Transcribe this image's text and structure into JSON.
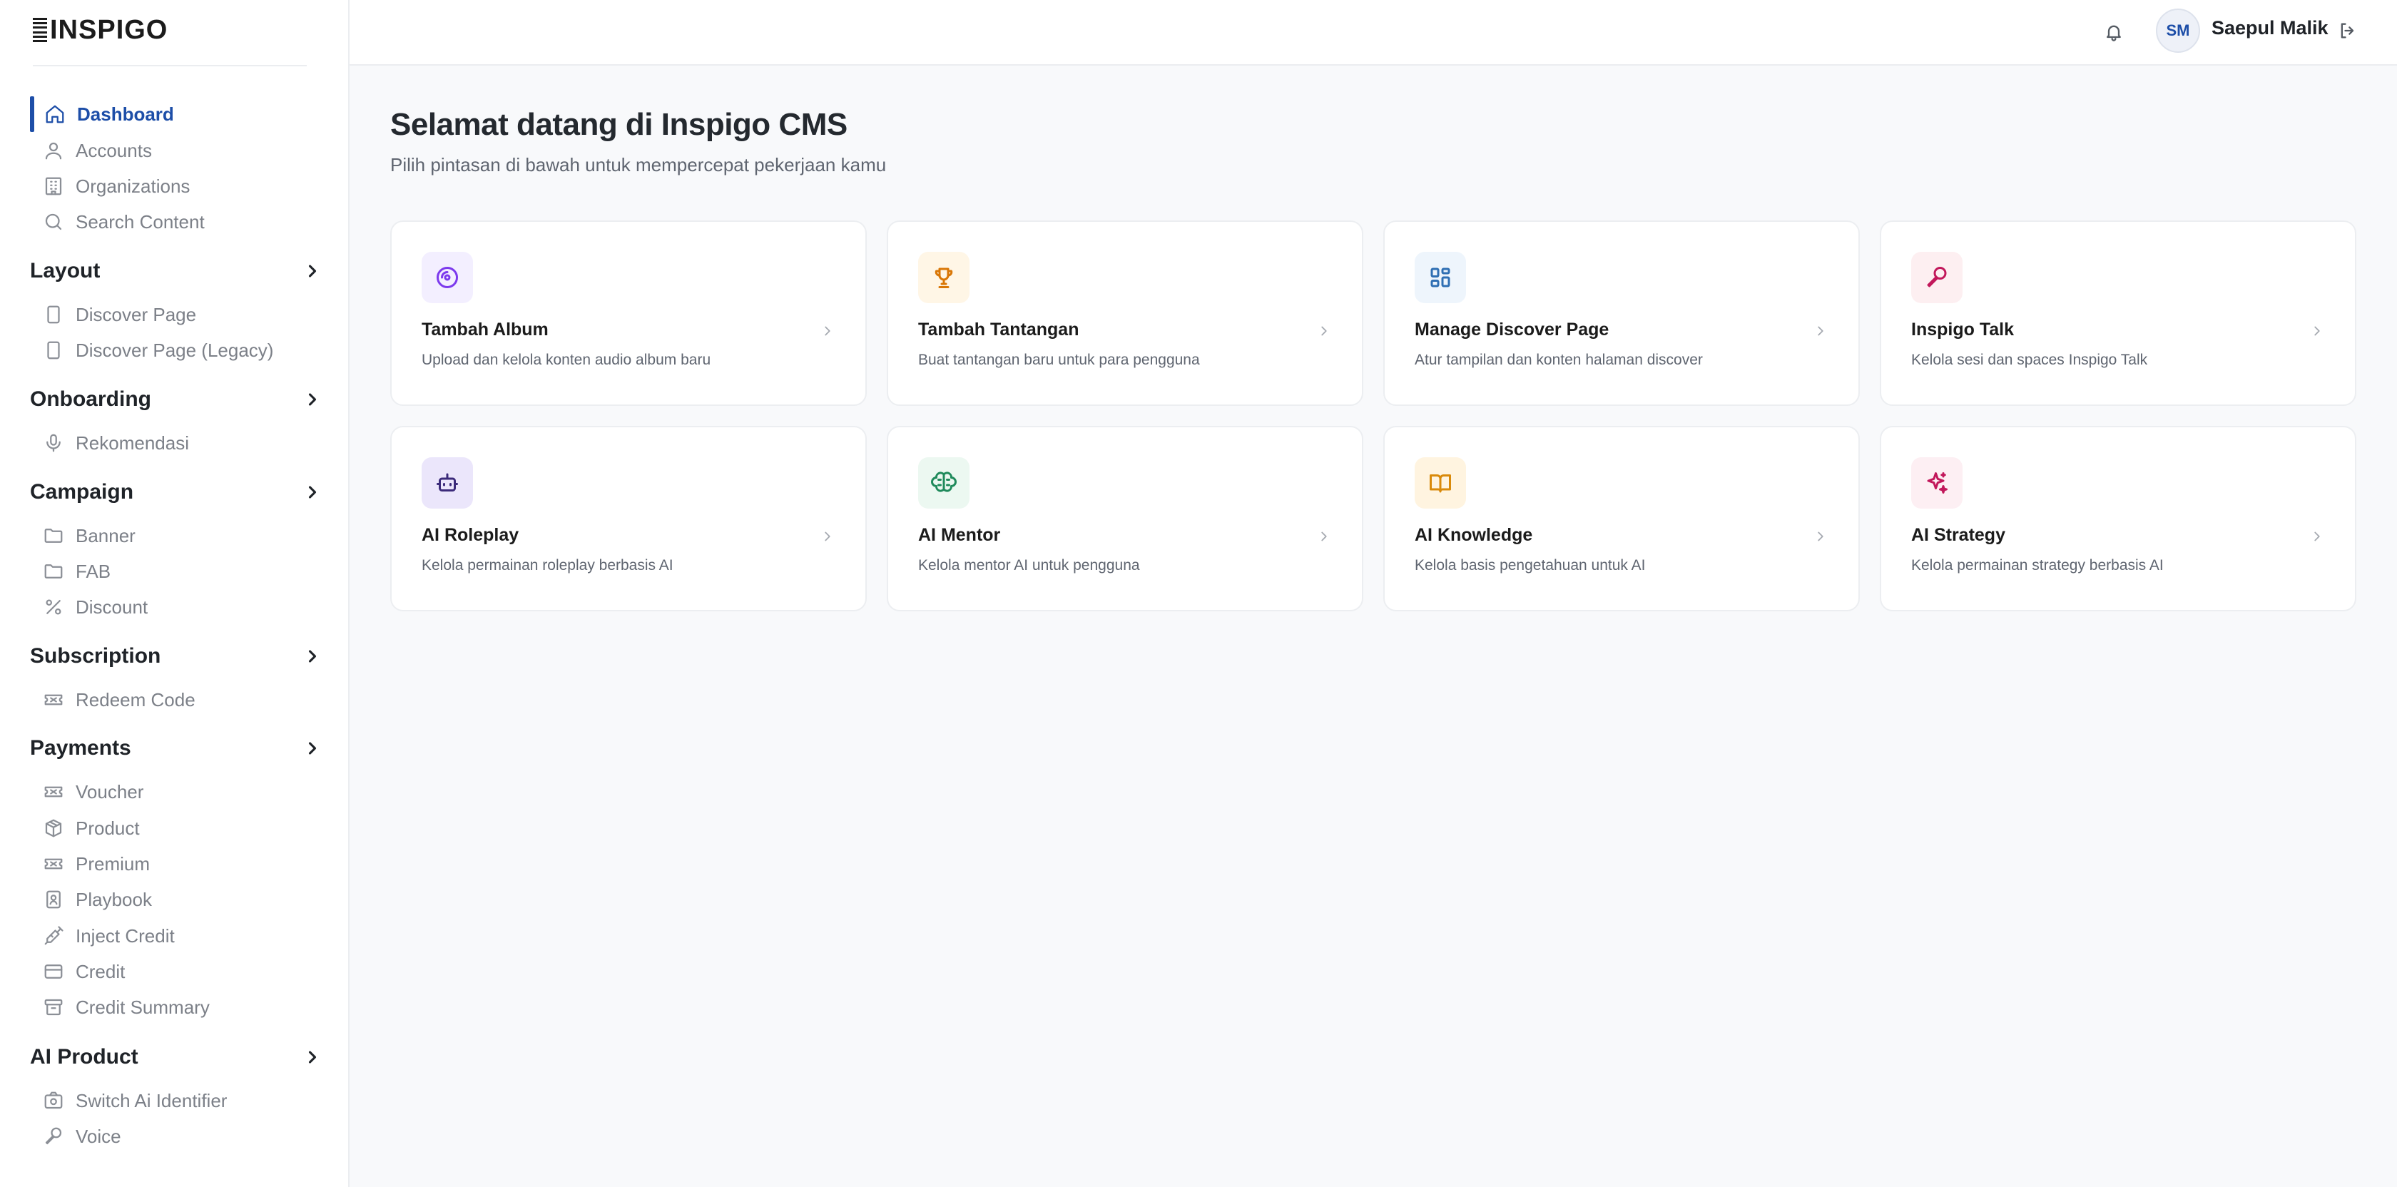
{
  "app": {
    "logo_text": "INSPIGO"
  },
  "sidebar": {
    "items": {
      "dashboard": "Dashboard",
      "accounts": "Accounts",
      "organizations": "Organizations",
      "search_content": "Search Content",
      "discover_page": "Discover Page",
      "discover_page_legacy": "Discover Page (Legacy)",
      "rekomendasi": "Rekomendasi",
      "banner": "Banner",
      "fab": "FAB",
      "discount": "Discount",
      "redeem_code": "Redeem Code",
      "voucher": "Voucher",
      "product": "Product",
      "premium": "Premium",
      "playbook": "Playbook",
      "inject_credit": "Inject Credit",
      "credit": "Credit",
      "credit_summary": "Credit Summary",
      "switch_ai_identifier": "Switch Ai Identifier",
      "voice": "Voice"
    },
    "sections": {
      "layout": "Layout",
      "onboarding": "Onboarding",
      "campaign": "Campaign",
      "subscription": "Subscription",
      "payments": "Payments",
      "ai_product": "AI Product"
    }
  },
  "header": {
    "avatar_initials": "SM",
    "user_name": "Saepul Malik"
  },
  "main": {
    "title": "Selamat datang di Inspigo CMS",
    "subtitle": "Pilih pintasan di bawah untuk mempercepat pekerjaan kamu",
    "cards": [
      {
        "title": "Tambah Album",
        "desc": "Upload dan kelola konten audio album baru",
        "icon": "disc-icon",
        "color": "#7c3aed",
        "bg": "#f3efff"
      },
      {
        "title": "Tambah Tantangan",
        "desc": "Buat tantangan baru untuk para pengguna",
        "icon": "trophy-icon",
        "color": "#d97706",
        "bg": "#fff6e6"
      },
      {
        "title": "Manage Discover Page",
        "desc": "Atur tampilan dan konten halaman discover",
        "icon": "layout-grid-icon",
        "color": "#2f6fb3",
        "bg": "#eef5fc"
      },
      {
        "title": "Inspigo Talk",
        "desc": "Kelola sesi dan spaces Inspigo Talk",
        "icon": "microphone-icon",
        "color": "#c2185b",
        "bg": "#fdeff1"
      },
      {
        "title": "AI Roleplay",
        "desc": "Kelola permainan roleplay berbasis AI",
        "icon": "robot-icon",
        "color": "#3b2a7a",
        "bg": "#ebe6fb"
      },
      {
        "title": "AI Mentor",
        "desc": "Kelola mentor AI untuk pengguna",
        "icon": "brain-icon",
        "color": "#1f8a5b",
        "bg": "#ecf8f1"
      },
      {
        "title": "AI Knowledge",
        "desc": "Kelola basis pengetahuan untuk AI",
        "icon": "book-open-icon",
        "color": "#d98a0b",
        "bg": "#fff4e0"
      },
      {
        "title": "AI Strategy",
        "desc": "Kelola permainan strategy berbasis AI",
        "icon": "sparkles-icon",
        "color": "#c2185b",
        "bg": "#fdeff3"
      }
    ]
  },
  "colors": {
    "accent": "#1d4ea8",
    "sidebar_text": "#7c8088",
    "background": "#f8f9fb"
  }
}
